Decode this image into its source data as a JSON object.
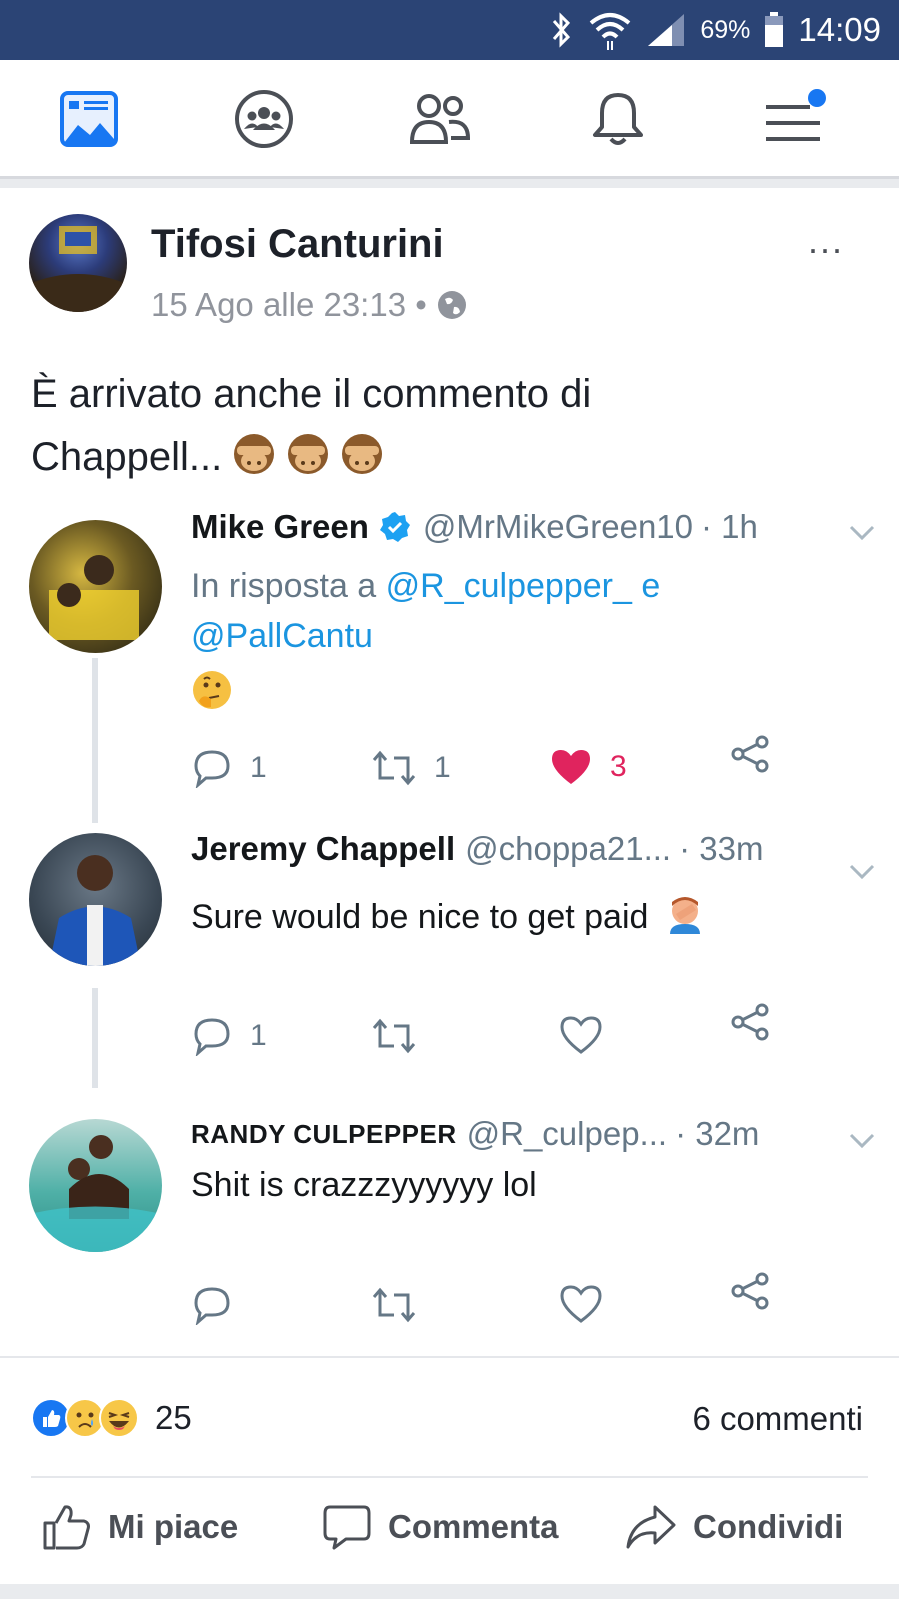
{
  "status_bar": {
    "battery_percent": "69%",
    "time": "14:09",
    "icons": [
      "bluetooth-icon",
      "wifi-icon",
      "signal-icon",
      "battery-icon"
    ]
  },
  "nav": {
    "items": [
      {
        "name": "news-feed",
        "icon": "news-feed-icon",
        "active": true
      },
      {
        "name": "groups",
        "icon": "groups-icon",
        "active": false
      },
      {
        "name": "friends",
        "icon": "friends-icon",
        "active": false
      },
      {
        "name": "notifications",
        "icon": "bell-icon",
        "active": false
      },
      {
        "name": "menu",
        "icon": "menu-icon",
        "active": false,
        "badge": true
      }
    ],
    "active_color": "#1877f2"
  },
  "post": {
    "author": "Tifosi Canturini",
    "timestamp": "15 Ago alle 23:13 •",
    "privacy_icon": "globe-icon",
    "more_label": "...",
    "text_line1": "È arrivato anche il commento di",
    "text_line2": "Chappell...",
    "emojis": [
      "see-no-evil-monkey",
      "see-no-evil-monkey",
      "see-no-evil-monkey"
    ]
  },
  "tweets": [
    {
      "name": "Mike Green",
      "verified": true,
      "handle": "@MrMikeGreen10",
      "time": "· 1h",
      "reply_prefix": "In risposta a",
      "reply_user1": "@R_culpepper_",
      "reply_joiner": "e",
      "reply_user2": "@PallCantu",
      "emoji": "thinking-face",
      "replies": "1",
      "retweets": "1",
      "likes": "3",
      "liked": true
    },
    {
      "name": "Jeremy Chappell",
      "verified": false,
      "handle": "@choppa21...",
      "time": "· 33m",
      "text": "Sure would be nice to get paid",
      "emoji": "man-facepalming",
      "replies": "1",
      "retweets": "",
      "likes": "",
      "liked": false
    },
    {
      "name": "RANDY CULPEPPER",
      "verified": false,
      "handle": "@R_culpep...",
      "time": "· 32m",
      "text": "Shit is crazzzyyyyyy lol",
      "replies": "",
      "retweets": "",
      "likes": "",
      "liked": false
    }
  ],
  "footer": {
    "reactions": [
      "like",
      "sad",
      "haha"
    ],
    "reaction_count": "25",
    "comments": "6 commenti",
    "like_label": "Mi piace",
    "comment_label": "Commenta",
    "share_label": "Condividi"
  }
}
